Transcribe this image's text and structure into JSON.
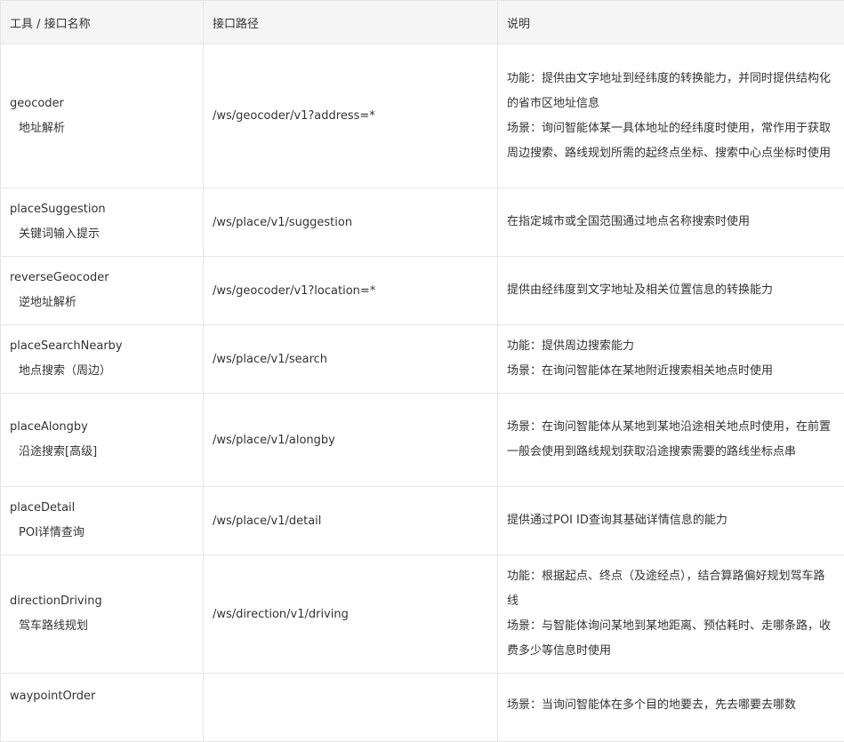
{
  "table": {
    "headers": [
      "工具 / 接口名称",
      "接口路径",
      "说明"
    ],
    "rows": [
      {
        "tool": "geocoder",
        "tool_cn": "地址解析",
        "path": "/ws/geocoder/v1?address=*",
        "desc": [
          "功能：提供由文字地址到经纬度的转换能力，并同时提供结构化的省市区地址信息",
          "场景：询问智能体某一具体地址的经纬度时使用，常作用于获取周边搜索、路线规划所需的起终点坐标、搜索中心点坐标时使用"
        ]
      },
      {
        "tool": "placeSuggestion",
        "tool_cn": "关键词输入提示",
        "path": "/ws/place/v1/suggestion",
        "desc": [
          "在指定城市或全国范围通过地点名称搜索时使用"
        ]
      },
      {
        "tool": "reverseGeocoder",
        "tool_cn": "逆地址解析",
        "path": "/ws/geocoder/v1?location=*",
        "desc": [
          "提供由经纬度到文字地址及相关位置信息的转换能力"
        ]
      },
      {
        "tool": "placeSearchNearby",
        "tool_cn": "地点搜索（周边）",
        "path": "/ws/place/v1/search",
        "desc": [
          "功能：提供周边搜索能力",
          "场景：在询问智能体在某地附近搜索相关地点时使用"
        ]
      },
      {
        "tool": "placeAlongby",
        "tool_cn": "沿途搜索[高级]",
        "path": "/ws/place/v1/alongby",
        "desc": [
          "场景：在询问智能体从某地到某地沿途相关地点时使用，在前置一般会使用到路线规划获取沿途搜索需要的路线坐标点串"
        ]
      },
      {
        "tool": "placeDetail",
        "tool_cn": "POI详情查询",
        "path": "/ws/place/v1/detail",
        "desc": [
          "提供通过POI ID查询其基础详情信息的能力"
        ]
      },
      {
        "tool": "directionDriving",
        "tool_cn": "驾车路线规划",
        "path": "/ws/direction/v1/driving",
        "desc": [
          "功能：根据起点、终点（及途经点），结合算路偏好规划驾车路线",
          "场景：与智能体询问某地到某地距离、预估耗时、走哪条路，收费多少等信息时使用"
        ]
      },
      {
        "tool": "waypointOrder",
        "tool_cn": "",
        "path": "",
        "desc": [
          "场景：当询问智能体在多个目的地要去，先去哪要去哪数"
        ]
      }
    ]
  }
}
